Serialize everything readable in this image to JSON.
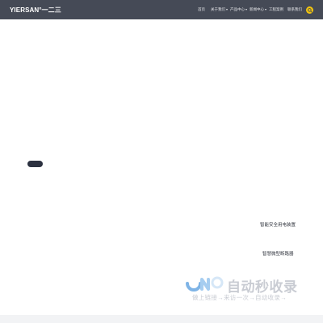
{
  "header": {
    "logo": "YIERSAN°一二三",
    "nav": [
      {
        "label": "首页",
        "has_dropdown": false
      },
      {
        "label": "关于我们",
        "has_dropdown": true
      },
      {
        "label": "产品中心",
        "has_dropdown": true
      },
      {
        "label": "新闻中心",
        "has_dropdown": true
      },
      {
        "label": "工程案例",
        "has_dropdown": false
      },
      {
        "label": "联系我们",
        "has_dropdown": false
      }
    ],
    "search_icon": "search-icon",
    "accent_color": "#f1c40f",
    "bar_color": "#454a56"
  },
  "hero": {
    "button_color": "#2c3140"
  },
  "products": [
    {
      "label": "智能安全用电装置"
    },
    {
      "label": "智慧微型断路器"
    }
  ],
  "watermark": {
    "title": "自动秒收录",
    "tagline": "做上链接→来访一次→自动收录→"
  }
}
